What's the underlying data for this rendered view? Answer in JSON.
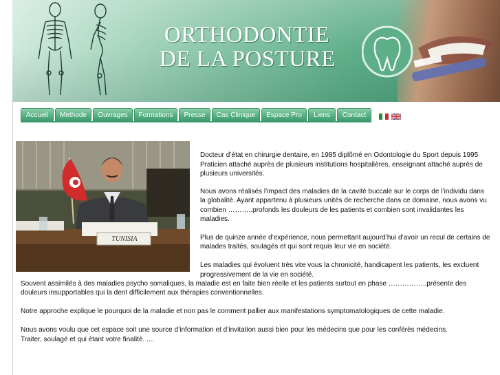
{
  "banner": {
    "title_line1": "ORTHODONTIE",
    "title_line2": "DE LA POSTURE"
  },
  "nav": {
    "tabs": [
      {
        "label": "Accueil"
      },
      {
        "label": "Methode"
      },
      {
        "label": "Ouvrages"
      },
      {
        "label": "Formations"
      },
      {
        "label": "Presse"
      },
      {
        "label": "Cas Clinique"
      },
      {
        "label": "Espace Pro"
      },
      {
        "label": "Liens"
      },
      {
        "label": "Contact"
      }
    ],
    "languages": [
      "flag-italy-icon",
      "flag-uk-icon"
    ]
  },
  "photo": {
    "nameplate": "TUNISIA"
  },
  "content": {
    "lines": [
      "Docteur d’état en chirurgie  dentaire, en 1985 diplômé en Odontologie du Sport depuis 1995",
      "Praticien attaché auprès de plusieurs institutions hospitalières, enseignant attaché auprès de",
      "plusieurs universités.",
      "Nous avons réalisés l’impact des maladies de la cavité buccale  sur le corps de l’individu  dans",
      "la globalité. Ayant appartenu à  plusieurs unités de recherche dans ce domaine, nous avons vu",
      "combien  ………..profonds les douleurs de les patients et combien sont invalidantes les",
      "maladies.",
      "Plus de quinze année d’expérience, nous permettant aujourd’hui d’avoir un recul de certains de",
      "malades traités, soulagés et qui  sont requis leur vie en société.",
      "Les maladies qui évoluent très vite vous la chronicité,  handicapent les patients, les excluent",
      "progressivement de la vie en société.",
      "Souvent assimilés à des maladies psycho somaliques, la maladie  est en faite bien réelle et les patients surtout en phase ……………..présente des",
      "douleurs  insupportables qui la dent difficilement aux thérapies conventionnelles.",
      "Notre approche explique le pourquoi de la maladie et non pas le comment pallier aux manifestations symptomatologiques de cette maladie.",
      "Nous avons voulu que cet espace  soit une source d’information et d’invitation aussi bien pour les médecins que pour les conférès médecins.",
      "Traiter, soulagé et qui étant votre finalité. ...."
    ]
  },
  "colors": {
    "tab_green": "#55b083",
    "banner_green": "#83c2a4"
  }
}
